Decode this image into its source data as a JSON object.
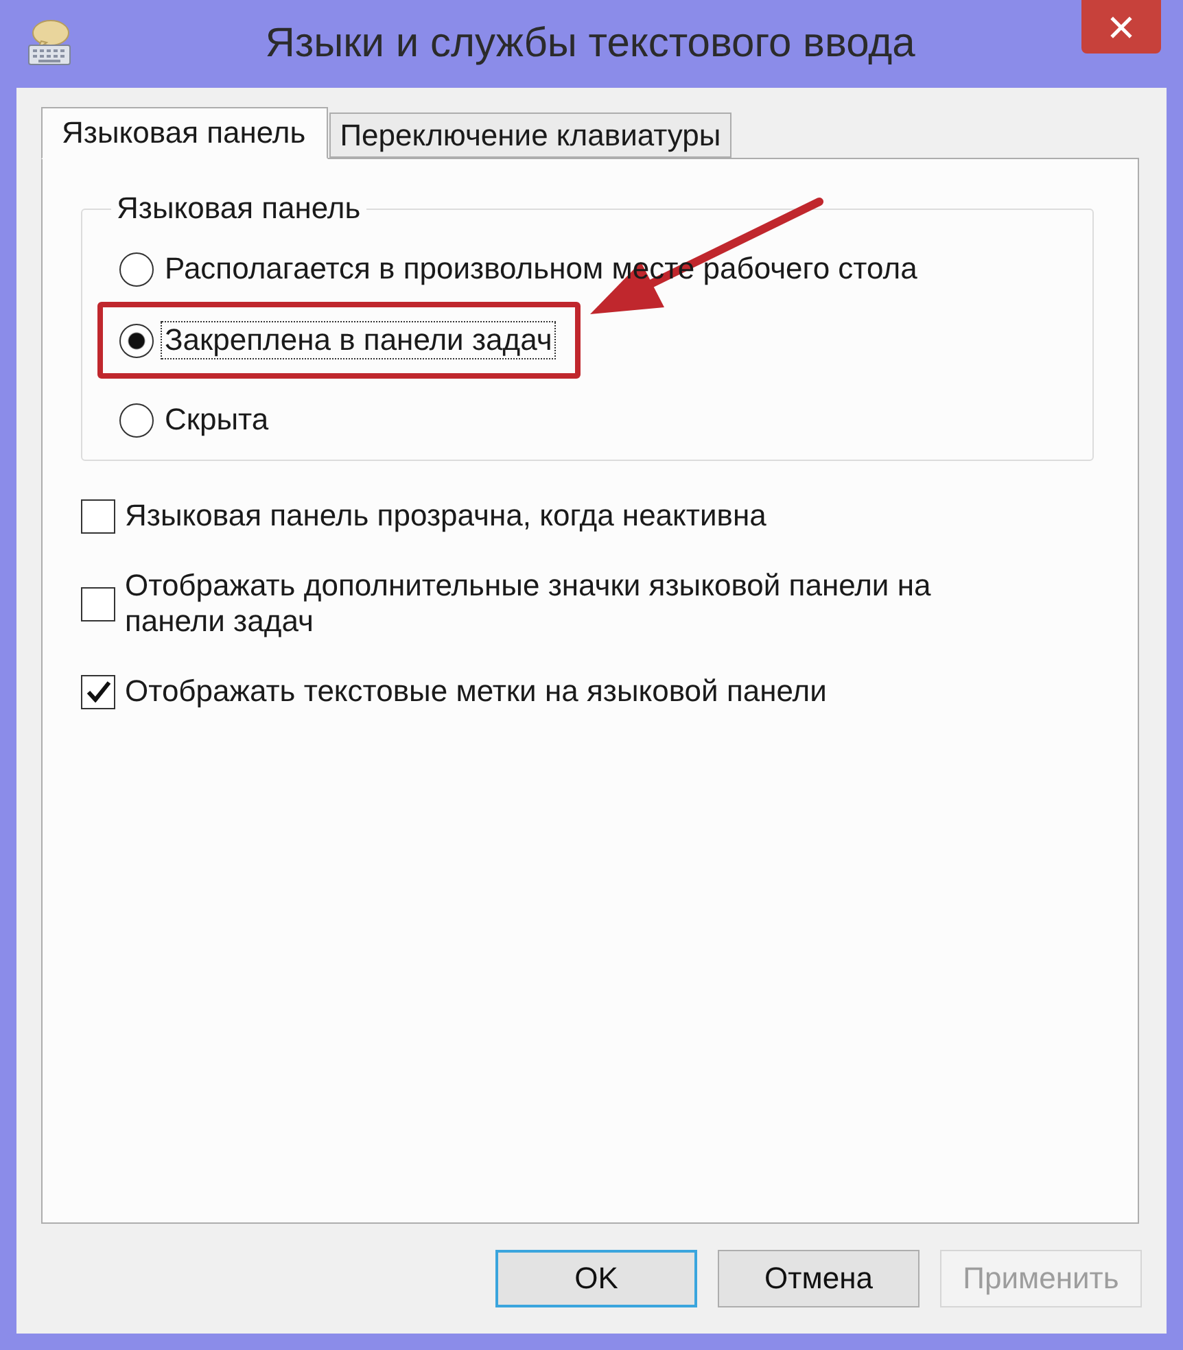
{
  "window": {
    "title": "Языки и службы текстового ввода"
  },
  "tabs": [
    {
      "label": "Языковая панель",
      "selected": true
    },
    {
      "label": "Переключение клавиатуры",
      "selected": false
    }
  ],
  "language_bar_group": {
    "title": "Языковая панель",
    "options": [
      {
        "label": "Располагается в произвольном месте рабочего стола",
        "selected": false,
        "focused": false,
        "highlighted": false
      },
      {
        "label": "Закреплена в панели задач",
        "selected": true,
        "focused": true,
        "highlighted": true
      },
      {
        "label": "Скрыта",
        "selected": false,
        "focused": false,
        "highlighted": false
      }
    ]
  },
  "checkboxes": [
    {
      "label": "Языковая панель прозрачна, когда неактивна",
      "checked": false
    },
    {
      "label": "Отображать дополнительные значки языковой панели на панели задач",
      "checked": false
    },
    {
      "label": "Отображать текстовые метки на языковой панели",
      "checked": true
    }
  ],
  "buttons": [
    {
      "label": "OK",
      "default": true,
      "disabled": false
    },
    {
      "label": "Отмена",
      "default": false,
      "disabled": false
    },
    {
      "label": "Применить",
      "default": false,
      "disabled": true
    }
  ],
  "annotations": [
    {
      "kind": "arrow"
    }
  ]
}
